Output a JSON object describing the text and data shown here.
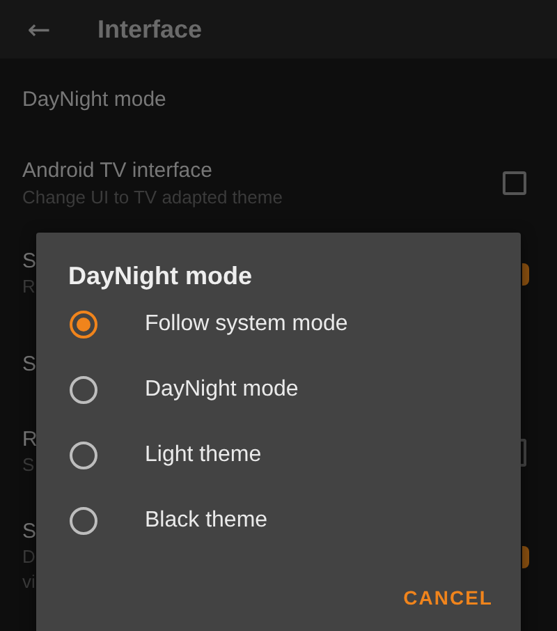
{
  "toolbar": {
    "back": "←",
    "title": "Interface"
  },
  "settings": [
    {
      "title": "DayNight mode",
      "kind": "plain"
    },
    {
      "title": "Android TV interface",
      "summary": "Change UI to TV adapted theme",
      "kind": "checkbox",
      "checked": false
    }
  ],
  "covered_settings": [
    {
      "lines": [
        "S",
        "R"
      ],
      "kind": "switch",
      "checked": true
    },
    {
      "lines": [
        "S"
      ],
      "kind": "plain"
    },
    {
      "lines": [
        "R",
        "S"
      ],
      "kind": "checkbox",
      "checked": false
    },
    {
      "lines": [
        "S",
        "D",
        "vi"
      ],
      "kind": "switch",
      "checked": true
    }
  ],
  "dialog": {
    "title": "DayNight mode",
    "options": [
      {
        "label": "Follow system mode",
        "selected": true
      },
      {
        "label": "DayNight mode",
        "selected": false
      },
      {
        "label": "Light theme",
        "selected": false
      },
      {
        "label": "Black theme",
        "selected": false
      }
    ],
    "buttons": [
      "CANCEL"
    ]
  }
}
